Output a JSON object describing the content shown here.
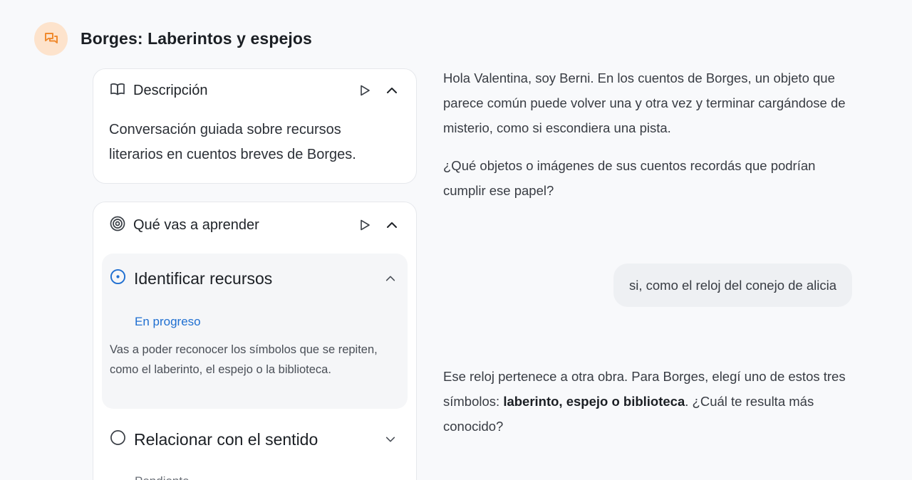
{
  "header": {
    "title": "Borges: Laberintos y espejos",
    "avatar_icon": "chat-bubbles-icon",
    "accent_color": "#f08a2e"
  },
  "description": {
    "title": "Descripción",
    "icon": "book-open-icon",
    "text": "Conversación guiada sobre recursos literarios en cuentos breves de Borges."
  },
  "learn": {
    "title": "Qué vas a aprender",
    "icon": "target-icon",
    "objectives": [
      {
        "title": "Identificar recursos",
        "status": "En progreso",
        "status_color": "#1f6fd1",
        "description": "Vas a poder reconocer los símbolos que se repiten, como el laberinto, el espejo o la biblioteca."
      },
      {
        "title": "Relacionar con el sentido",
        "status": "Pendiente"
      }
    ]
  },
  "chat": {
    "bot_intro_1": "Hola Valentina, soy Berni. En los cuentos de Borges, un objeto que parece común puede volver una y otra vez y terminar cargándose de misterio, como si escondiera una pista.",
    "bot_intro_2": "¿Qué objetos o imágenes de sus cuentos recordás que podrían cumplir ese papel?",
    "user_reply": "si, como el reloj del conejo de alicia",
    "bot_reply_pre": "Ese reloj pertenece a otra obra. Para Borges, elegí uno de estos tres símbolos: ",
    "bot_reply_bold": "laberinto, espejo o biblioteca",
    "bot_reply_post": ". ¿Cuál te resulta más conocido?"
  }
}
